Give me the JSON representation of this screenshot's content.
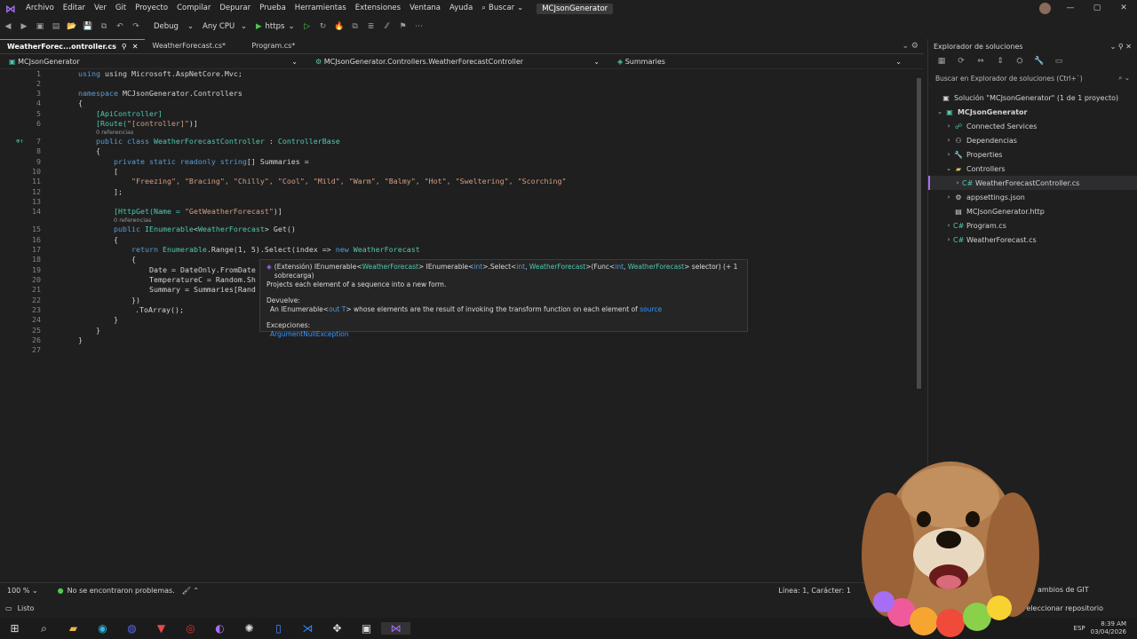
{
  "menu": {
    "items": [
      "Archivo",
      "Editar",
      "Ver",
      "Git",
      "Proyecto",
      "Compilar",
      "Depurar",
      "Prueba",
      "Herramientas",
      "Extensiones",
      "Ventana",
      "Ayuda"
    ],
    "search": "Buscar",
    "solution_title": "MCJsonGenerator"
  },
  "toolbar": {
    "config": "Debug",
    "platform": "Any CPU",
    "run_profile": "https"
  },
  "tabs": [
    {
      "label": "WeatherForec...ontroller.cs",
      "active": true
    },
    {
      "label": "WeatherForecast.cs*",
      "active": false
    },
    {
      "label": "Program.cs*",
      "active": false
    }
  ],
  "navbar": {
    "project": "MCJsonGenerator",
    "class": "MCJsonGenerator.Controllers.WeatherForecastController",
    "member": "Summaries"
  },
  "code": {
    "l1": "using Microsoft.AspNetCore.Mvc;",
    "l3a": "namespace",
    "l3b": " MCJsonGenerator.Controllers",
    "l4": "{",
    "l5": "[ApiController]",
    "l6a": "[Route(",
    "l6b": "\"[controller]\"",
    "l6c": ")]",
    "ref": "0 referencias",
    "l7a": "public class",
    "l7b": " WeatherForecastController",
    "l7c": " : ",
    "l7d": "ControllerBase",
    "l8": "{",
    "l9a": "private static readonly string",
    "l9b": "[] Summaries =",
    "l10": "[",
    "l11": "\"Freezing\", \"Bracing\", \"Chilly\", \"Cool\", \"Mild\", \"Warm\", \"Balmy\", \"Hot\", \"Sweltering\", \"Scorching\"",
    "l12": "];",
    "l14a": "[HttpGet(Name = ",
    "l14b": "\"GetWeatherForecast\"",
    "l14c": ")]",
    "l15a": "public",
    "l15b": " IEnumerable",
    "l15c": "<",
    "l15d": "WeatherForecast",
    "l15e": "> Get()",
    "l16": "{",
    "l17a": "return",
    "l17b": " Enumerable",
    "l17c": ".Range(1, 5).Select(index => ",
    "l17d": "new",
    "l17e": " WeatherForecast",
    "l18": "{",
    "l19": "Date = DateOnly.FromDate",
    "l20": "TemperatureC = Random.Sh",
    "l21": "Summary = Summaries[Rand",
    "l22": "})",
    "l23": ".ToArray();",
    "l24": "}",
    "l25": "}",
    "l26": "}",
    "line_numbers": [
      "1",
      "2",
      "3",
      "4",
      "5",
      "6",
      "7",
      "8",
      "9",
      "10",
      "11",
      "12",
      "13",
      "14",
      "15",
      "16",
      "17",
      "18",
      "19",
      "20",
      "21",
      "22",
      "23",
      "24",
      "25",
      "26",
      "27"
    ]
  },
  "tooltip": {
    "signature_a": "(Extensión) IEnumerable<",
    "signature_b": "WeatherForecast",
    "signature_c": "> IEnumerable<",
    "signature_d": "int",
    "signature_e": ">.Select<",
    "signature_f": "int",
    "signature_g": ", ",
    "signature_h": "WeatherForecast",
    "signature_i": ">(Func<",
    "signature_j": "int",
    "signature_k": ", ",
    "signature_l": "WeatherForecast",
    "signature_m": "> selector) (+ 1 sobrecarga)",
    "summary": "Projects each element of a sequence into a new form.",
    "returns_label": "Devuelve:",
    "returns_a": "An IEnumerable<",
    "returns_b": "out T",
    "returns_c": "> whose elements are the result of invoking the transform function on each element of ",
    "returns_d": "source",
    "exceptions_label": "Excepciones:",
    "exception": "ArgumentNullException"
  },
  "statusbar": {
    "zoom": "100 %",
    "issues": "No se encontraron problemas.",
    "position": "Línea: 1, Carácter: 1",
    "git": "ambios de GIT"
  },
  "solution_explorer": {
    "title": "Explorador de soluciones",
    "search_placeholder": "Buscar en Explorador de soluciones (Ctrl+`)",
    "items": [
      {
        "label": "Solución \"MCJsonGenerator\" (1 de 1 proyecto)"
      },
      {
        "label": "MCJsonGenerator"
      },
      {
        "label": "Connected Services"
      },
      {
        "label": "Dependencias"
      },
      {
        "label": "Properties"
      },
      {
        "label": "Controllers"
      },
      {
        "label": "WeatherForecastController.cs"
      },
      {
        "label": "appsettings.json"
      },
      {
        "label": "MCJsonGenerator.http"
      },
      {
        "label": "Program.cs"
      },
      {
        "label": "WeatherForecast.cs"
      }
    ]
  },
  "app_status": {
    "ready": "Listo",
    "repo": "eleccionar repositorio"
  },
  "clock": {
    "time": "8:39 AM",
    "date": "03/04/2026",
    "lang": "ESP"
  },
  "colors": {
    "accent": "#a66ef5",
    "keyword": "#569cd6",
    "type": "#4ec9b0",
    "string": "#d69d85"
  }
}
